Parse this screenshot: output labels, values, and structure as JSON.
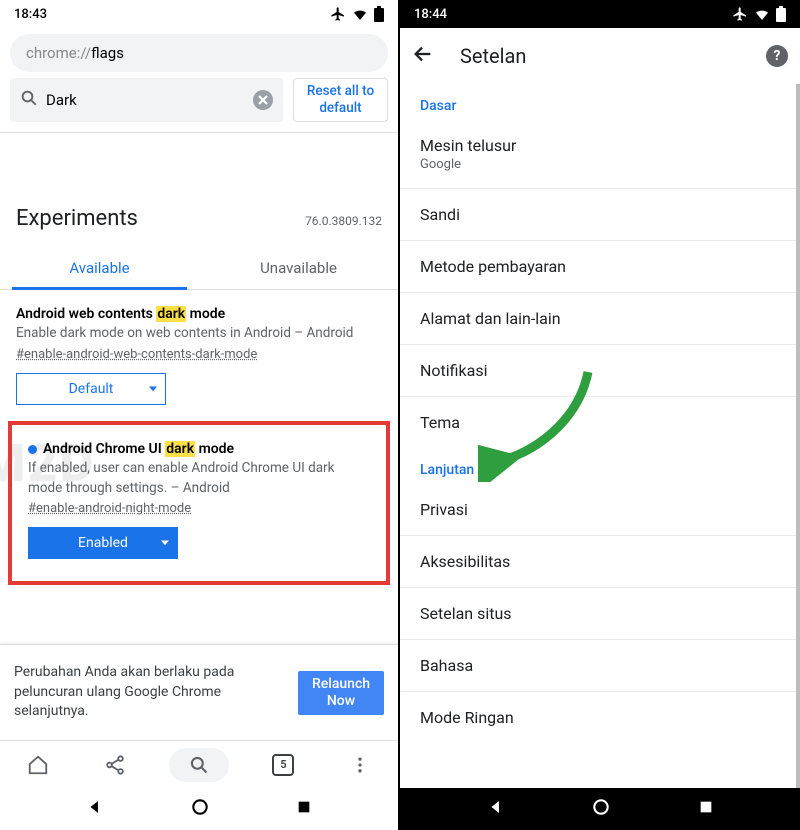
{
  "left": {
    "status": {
      "time": "18:43"
    },
    "omnibox": {
      "prefix": "chrome://",
      "suffix": "flags"
    },
    "search": {
      "value": "Dark",
      "reset_label": "Reset all to default"
    },
    "header": {
      "title": "Experiments",
      "version": "76.0.3809.132"
    },
    "tabs": {
      "available": "Available",
      "unavailable": "Unavailable"
    },
    "flag1": {
      "title_pre": "Android web contents ",
      "title_hl": "dark",
      "title_post": " mode",
      "desc": "Enable dark mode on web contents in Android – Android",
      "anchor": "#enable-android-web-contents-dark-mode",
      "select": "Default"
    },
    "flag2": {
      "title_pre": "Android Chrome UI ",
      "title_hl": "dark",
      "title_post": " mode",
      "desc": "If enabled, user can enable Android Chrome UI dark mode through settings. – Android",
      "anchor": "#enable-android-night-mode",
      "select": "Enabled"
    },
    "restart": {
      "msg": "Perubahan Anda akan berlaku pada peluncuran ulang Google Chrome selanjutnya.",
      "btn": "Relaunch Now"
    },
    "toolbar": {
      "tab_count": "5"
    },
    "watermark": "M2D"
  },
  "right": {
    "status": {
      "time": "18:44"
    },
    "appbar": {
      "title": "Setelan"
    },
    "sections": {
      "basic_label": "Dasar",
      "advanced_label": "Lanjutan",
      "search_engine": "Mesin telusur",
      "search_engine_sub": "Google",
      "password": "Sandi",
      "payment": "Metode pembayaran",
      "address": "Alamat dan lain-lain",
      "notif": "Notifikasi",
      "theme": "Tema",
      "privacy": "Privasi",
      "a11y": "Aksesibilitas",
      "site": "Setelan situs",
      "lang": "Bahasa",
      "lite": "Mode Ringan"
    }
  }
}
